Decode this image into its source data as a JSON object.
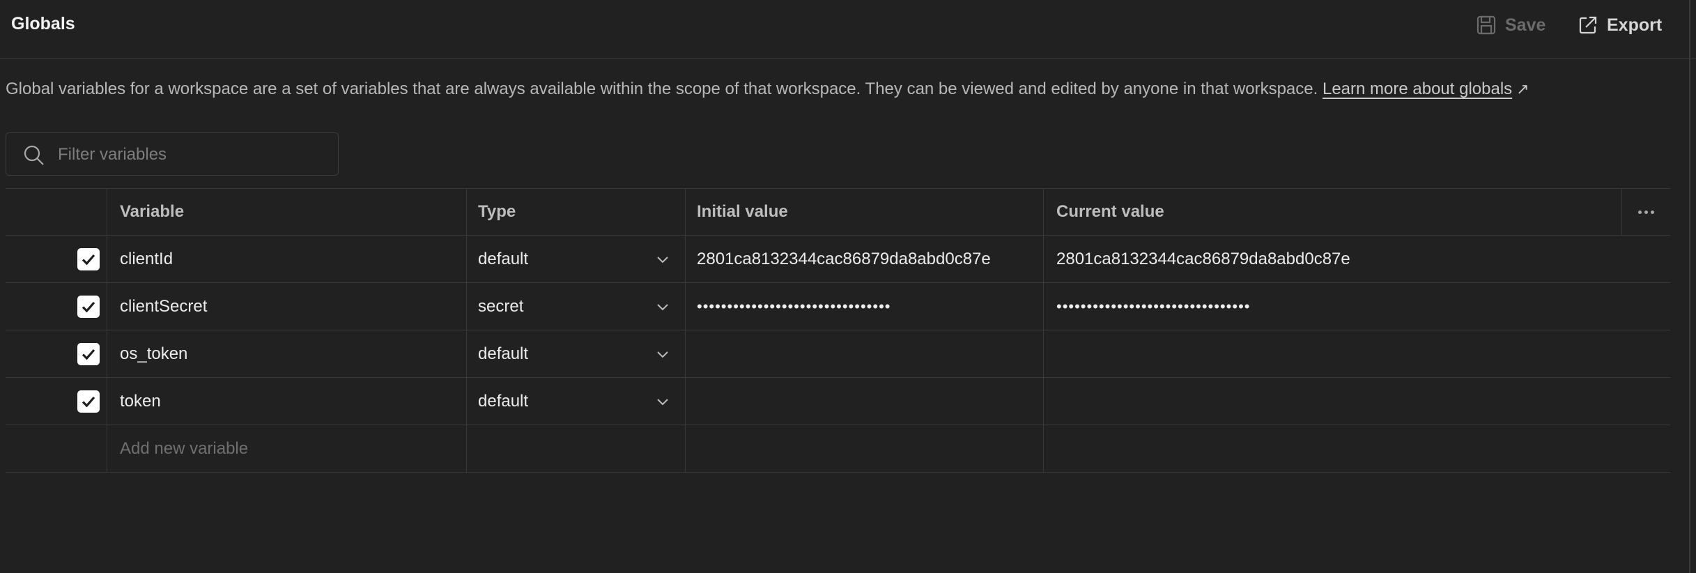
{
  "header": {
    "title": "Globals",
    "save_label": "Save",
    "export_label": "Export"
  },
  "description": {
    "text": "Global variables for a workspace are a set of variables that are always available within the scope of that workspace. They can be viewed and edited by anyone in that workspace.",
    "link": "Learn more about globals",
    "link_icon": "↗"
  },
  "filter": {
    "placeholder": "Filter variables",
    "value": ""
  },
  "table": {
    "columns": {
      "variable": "Variable",
      "type": "Type",
      "initial": "Initial value",
      "current": "Current value"
    },
    "rows": [
      {
        "checked": true,
        "name": "clientId",
        "type": "default",
        "initial": "2801ca8132344cac86879da8abd0c87e",
        "current": "2801ca8132344cac86879da8abd0c87e"
      },
      {
        "checked": true,
        "name": "clientSecret",
        "type": "secret",
        "initial": "••••••••••••••••••••••••••••••••",
        "current": "••••••••••••••••••••••••••••••••"
      },
      {
        "checked": true,
        "name": "os_token",
        "type": "default",
        "initial": "",
        "current": ""
      },
      {
        "checked": true,
        "name": "token",
        "type": "default",
        "initial": "",
        "current": ""
      }
    ],
    "add_placeholder": "Add new variable"
  },
  "colors": {
    "background": "#212121",
    "border": "#383838",
    "checkbox": "#ffffff"
  }
}
